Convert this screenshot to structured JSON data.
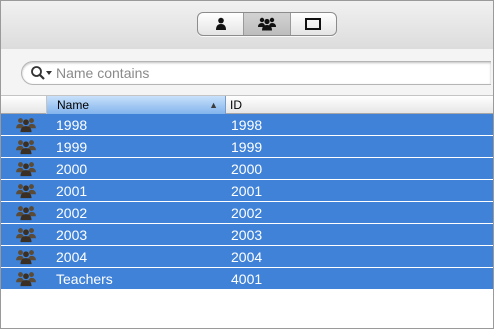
{
  "toolbar": {
    "segments": [
      {
        "icon": "user-icon",
        "selected": false
      },
      {
        "icon": "group-icon",
        "selected": true
      },
      {
        "icon": "computer-icon",
        "selected": false
      }
    ]
  },
  "search": {
    "placeholder": "Name contains",
    "value": ""
  },
  "table": {
    "columns": [
      {
        "label": "Name",
        "sorted": true,
        "sort_direction": "ascending"
      },
      {
        "label": "ID"
      }
    ],
    "sort_indicator": "▲",
    "selection_color": "#3f82d8",
    "rows": [
      {
        "icon": "group-icon",
        "name": "1998",
        "id": "1998"
      },
      {
        "icon": "group-icon",
        "name": "1999",
        "id": "1999"
      },
      {
        "icon": "group-icon",
        "name": "2000",
        "id": "2000"
      },
      {
        "icon": "group-icon",
        "name": "2001",
        "id": "2001"
      },
      {
        "icon": "group-icon",
        "name": "2002",
        "id": "2002"
      },
      {
        "icon": "group-icon",
        "name": "2003",
        "id": "2003"
      },
      {
        "icon": "group-icon",
        "name": "2004",
        "id": "2004"
      },
      {
        "icon": "group-icon",
        "name": "Teachers",
        "id": "4001"
      }
    ]
  }
}
